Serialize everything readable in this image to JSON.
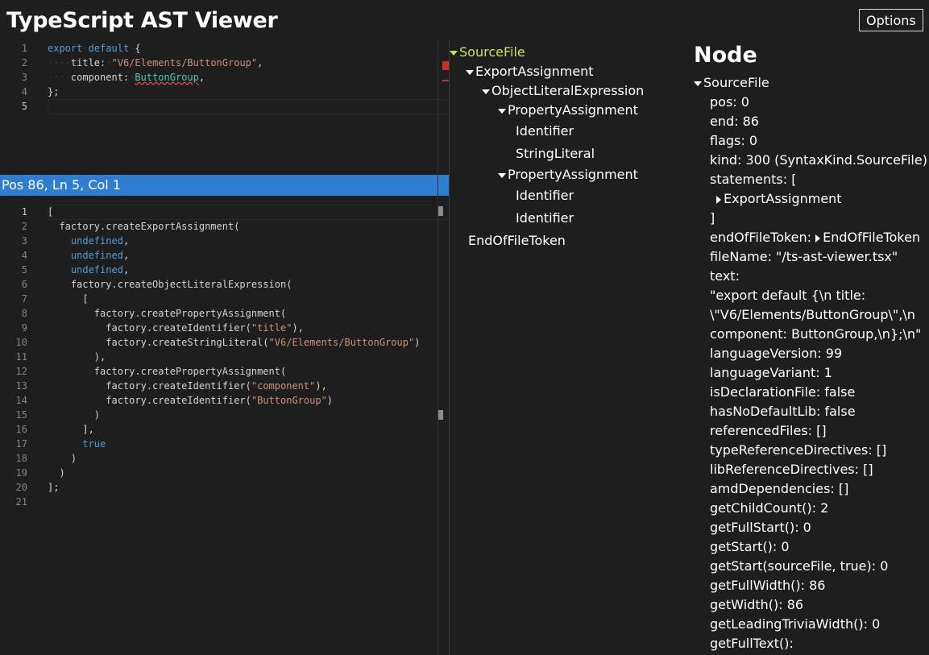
{
  "app": {
    "title": "TypeScript AST Viewer",
    "options_label": "Options"
  },
  "editor_top": {
    "lines": [
      {
        "num": "1",
        "tokens": [
          {
            "t": "export",
            "c": "kw"
          },
          {
            "t": "·",
            "c": "ws"
          },
          {
            "t": "default",
            "c": "kw"
          },
          {
            "t": "·",
            "c": "ws"
          },
          {
            "t": "{",
            "c": ""
          }
        ]
      },
      {
        "num": "2",
        "tokens": [
          {
            "t": "····",
            "c": "ws"
          },
          {
            "t": "title:",
            "c": ""
          },
          {
            "t": "·",
            "c": "ws"
          },
          {
            "t": "\"V6/Elements/ButtonGroup\"",
            "c": "str"
          },
          {
            "t": ",",
            "c": ""
          }
        ]
      },
      {
        "num": "3",
        "tokens": [
          {
            "t": "····",
            "c": "ws"
          },
          {
            "t": "component:",
            "c": ""
          },
          {
            "t": "·",
            "c": "ws"
          },
          {
            "t": "ButtonGroup",
            "c": "ident"
          },
          {
            "t": ",",
            "c": ""
          }
        ]
      },
      {
        "num": "4",
        "tokens": [
          {
            "t": "};",
            "c": ""
          }
        ]
      },
      {
        "num": "5",
        "tokens": [],
        "active": true
      }
    ]
  },
  "status": {
    "text": "Pos 86, Ln 5, Col 1"
  },
  "editor_bottom": {
    "lines": [
      {
        "num": "1",
        "tokens": [
          {
            "t": "[",
            "c": ""
          }
        ],
        "active": true
      },
      {
        "num": "2",
        "tokens": [
          {
            "t": "  factory.createExportAssignment(",
            "c": ""
          }
        ]
      },
      {
        "num": "3",
        "tokens": [
          {
            "t": "    ",
            "c": ""
          },
          {
            "t": "undefined",
            "c": "kw"
          },
          {
            "t": ",",
            "c": ""
          }
        ]
      },
      {
        "num": "4",
        "tokens": [
          {
            "t": "    ",
            "c": ""
          },
          {
            "t": "undefined",
            "c": "kw"
          },
          {
            "t": ",",
            "c": ""
          }
        ]
      },
      {
        "num": "5",
        "tokens": [
          {
            "t": "    ",
            "c": ""
          },
          {
            "t": "undefined",
            "c": "kw"
          },
          {
            "t": ",",
            "c": ""
          }
        ]
      },
      {
        "num": "6",
        "tokens": [
          {
            "t": "    factory.createObjectLiteralExpression(",
            "c": ""
          }
        ]
      },
      {
        "num": "7",
        "tokens": [
          {
            "t": "      [",
            "c": ""
          }
        ]
      },
      {
        "num": "8",
        "tokens": [
          {
            "t": "        factory.createPropertyAssignment(",
            "c": ""
          }
        ]
      },
      {
        "num": "9",
        "tokens": [
          {
            "t": "          factory.createIdentifier(",
            "c": ""
          },
          {
            "t": "\"title\"",
            "c": "str"
          },
          {
            "t": "),",
            "c": ""
          }
        ]
      },
      {
        "num": "10",
        "tokens": [
          {
            "t": "          factory.createStringLiteral(",
            "c": ""
          },
          {
            "t": "\"V6/Elements/ButtonGroup\"",
            "c": "str"
          },
          {
            "t": ")",
            "c": ""
          }
        ]
      },
      {
        "num": "11",
        "tokens": [
          {
            "t": "        ),",
            "c": ""
          }
        ]
      },
      {
        "num": "12",
        "tokens": [
          {
            "t": "        factory.createPropertyAssignment(",
            "c": ""
          }
        ]
      },
      {
        "num": "13",
        "tokens": [
          {
            "t": "          factory.createIdentifier(",
            "c": ""
          },
          {
            "t": "\"component\"",
            "c": "str"
          },
          {
            "t": "),",
            "c": ""
          }
        ]
      },
      {
        "num": "14",
        "tokens": [
          {
            "t": "          factory.createIdentifier(",
            "c": ""
          },
          {
            "t": "\"ButtonGroup\"",
            "c": "str"
          },
          {
            "t": ")",
            "c": ""
          }
        ]
      },
      {
        "num": "15",
        "tokens": [
          {
            "t": "        )",
            "c": ""
          }
        ]
      },
      {
        "num": "16",
        "tokens": [
          {
            "t": "      ],",
            "c": ""
          }
        ]
      },
      {
        "num": "17",
        "tokens": [
          {
            "t": "      ",
            "c": ""
          },
          {
            "t": "true",
            "c": "kw"
          }
        ]
      },
      {
        "num": "18",
        "tokens": [
          {
            "t": "    )",
            "c": ""
          }
        ]
      },
      {
        "num": "19",
        "tokens": [
          {
            "t": "  )",
            "c": ""
          }
        ]
      },
      {
        "num": "20",
        "tokens": [
          {
            "t": "];",
            "c": ""
          }
        ]
      },
      {
        "num": "21",
        "tokens": []
      }
    ]
  },
  "tree": [
    {
      "label": "SourceFile",
      "depth": 0,
      "arrow": "down",
      "selected": true
    },
    {
      "label": "ExportAssignment",
      "depth": 1,
      "arrow": "down"
    },
    {
      "label": "ObjectLiteralExpression",
      "depth": 2,
      "arrow": "down"
    },
    {
      "label": "PropertyAssignment",
      "depth": 3,
      "arrow": "down"
    },
    {
      "label": "Identifier",
      "depth": 4,
      "arrow": "none"
    },
    {
      "label": "StringLiteral",
      "depth": 4,
      "arrow": "none"
    },
    {
      "label": "PropertyAssignment",
      "depth": 3,
      "arrow": "down"
    },
    {
      "label": "Identifier",
      "depth": 4,
      "arrow": "none"
    },
    {
      "label": "Identifier",
      "depth": 4,
      "arrow": "none"
    },
    {
      "label": "EndOfFileToken",
      "depth": 1,
      "arrow": "none"
    }
  ],
  "node_panel": {
    "title": "Node",
    "rows": [
      {
        "text": "SourceFile",
        "indent": 0,
        "arrow": "down"
      },
      {
        "text": "pos: 0",
        "indent": 1
      },
      {
        "text": "end: 86",
        "indent": 1
      },
      {
        "text": "flags: 0",
        "indent": 1
      },
      {
        "text": "kind: 300 (SyntaxKind.SourceFile)",
        "indent": 1
      },
      {
        "text": "statements: [",
        "indent": 1
      },
      {
        "text": "ExportAssignment",
        "indent": 2,
        "arrow": "right"
      },
      {
        "text": "]",
        "indent": 1
      },
      {
        "text": "endOfFileToken: ",
        "indent": 1,
        "suffix": "EndOfFileToken"
      },
      {
        "text": "fileName: \"/ts-ast-viewer.tsx\"",
        "indent": 1
      },
      {
        "text": "text:",
        "indent": 1
      },
      {
        "text": "\"export default {\\n title:",
        "indent": 1
      },
      {
        "text": "\\\"V6/Elements/ButtonGroup\\\",\\n",
        "indent": 1
      },
      {
        "text": "component: ButtonGroup,\\n};\\n\"",
        "indent": 1
      },
      {
        "text": "languageVersion: 99",
        "indent": 1
      },
      {
        "text": "languageVariant: 1",
        "indent": 1
      },
      {
        "text": "isDeclarationFile: false",
        "indent": 1
      },
      {
        "text": "hasNoDefaultLib: false",
        "indent": 1
      },
      {
        "text": "referencedFiles: []",
        "indent": 1
      },
      {
        "text": "typeReferenceDirectives: []",
        "indent": 1
      },
      {
        "text": "libReferenceDirectives: []",
        "indent": 1
      },
      {
        "text": "amdDependencies: []",
        "indent": 1
      },
      {
        "text": "getChildCount(): 2",
        "indent": 1
      },
      {
        "text": "getFullStart(): 0",
        "indent": 1
      },
      {
        "text": "getStart(): 0",
        "indent": 1
      },
      {
        "text": "getStart(sourceFile, true): 0",
        "indent": 1
      },
      {
        "text": "getFullWidth(): 86",
        "indent": 1
      },
      {
        "text": "getWidth(): 86",
        "indent": 1
      },
      {
        "text": "getLeadingTriviaWidth(): 0",
        "indent": 1
      },
      {
        "text": "getFullText():",
        "indent": 1
      }
    ]
  },
  "colors": {
    "statusbar": "#2f7dd1",
    "selected_tree_node": "#d2e05d",
    "keyword": "#569cd6",
    "string": "#ce9178",
    "identifier": "#4ec9b0"
  }
}
